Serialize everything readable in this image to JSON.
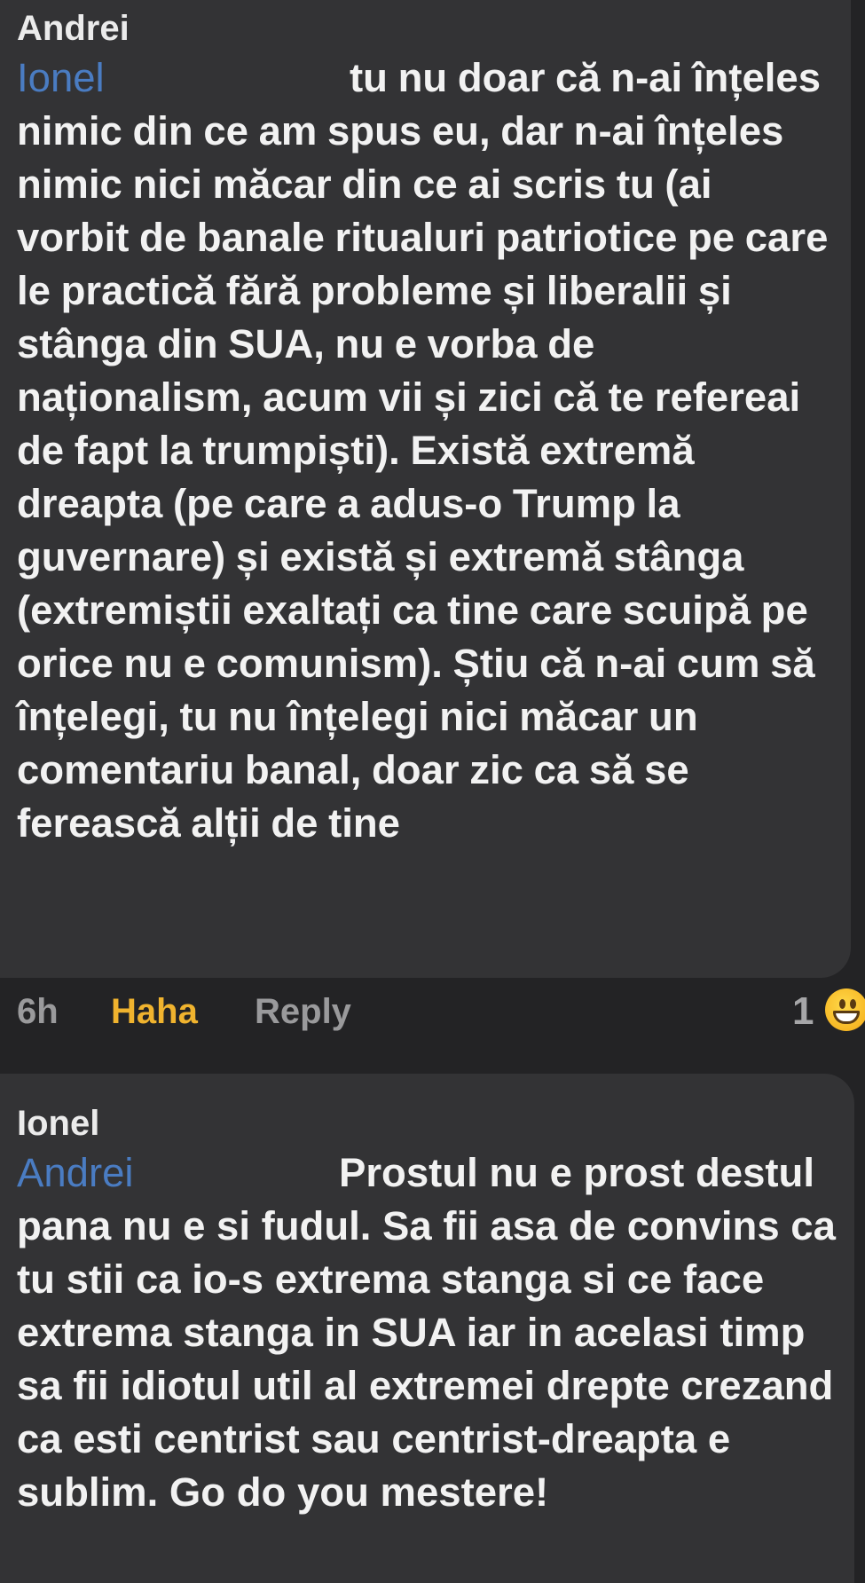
{
  "comments": [
    {
      "author": "Andrei",
      "mention": "Ionel",
      "text_first_line": "tu nu doar că n-ai",
      "text_rest": "înțeles nimic din ce am spus eu, dar n-ai înțeles nimic nici măcar din ce ai scris tu (ai vorbit de banale ritualuri patriotice pe care le practică fără probleme și liberalii și stânga din SUA, nu e vorba de naționalism, acum vii și zici că te refereai de fapt la trumpiști). Există extremă dreapta (pe care a adus-o Trump la guvernare) și există și extremă stânga (extremiștii exaltați ca tine care scuipă pe orice nu e comunism). Știu că n-ai cum să înțelegi, tu nu înțelegi nici măcar un comentariu banal, doar zic ca să se ferească alții de tine",
      "time": "6h",
      "reaction_action": "Haha",
      "reply_label": "Reply",
      "reaction_count": "1",
      "reaction_icon": "grinning-face-icon"
    },
    {
      "author": "Ionel",
      "mention": "Andrei",
      "text_first_line": "Prostul nu e prost",
      "text_rest": "destul pana nu e si fudul. Sa fii asa de convins ca tu stii ca io-s extrema stanga si ce face extrema stanga in SUA iar in acelasi timp sa fii idiotul util al extremei drepte crezand ca esti centrist sau centrist-dreapta e sublim. Go do you mestere!"
    }
  ],
  "colors": {
    "background": "#232325",
    "bubble": "#333335",
    "mention": "#4a7cc2",
    "haha": "#f0b32e",
    "muted": "#9a9a9c"
  }
}
